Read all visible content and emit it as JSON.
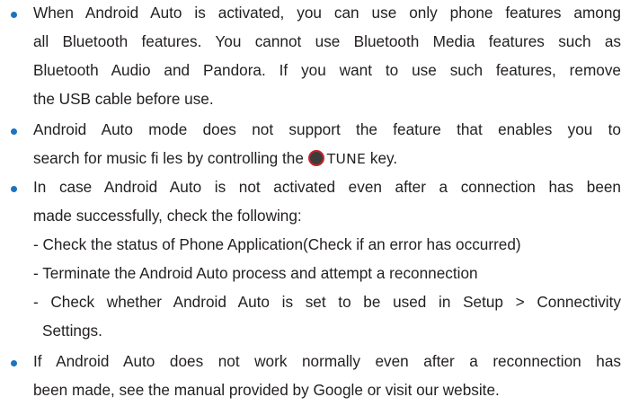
{
  "accent_color": "#1e73be",
  "bullets": [
    {
      "lines": [
        "When Android Auto is activated, you can use only phone features among",
        "all Bluetooth features. You cannot use Bluetooth Media features such as",
        "Bluetooth Audio and Pandora. If you want to use such features, remove",
        "the USB cable before use."
      ]
    },
    {
      "lines": [
        "Android Auto mode does not support the feature that enables you to",
        "search for music fi les by controlling the"
      ],
      "key_icon": "tune-knob-icon",
      "key_label": "TUNE",
      "key_suffix": " key."
    },
    {
      "lines": [
        "In case Android Auto is not activated even after a connection has been",
        "made successfully, check the following:"
      ],
      "sub_items": [
        "- Check the status of Phone Application(Check if an error has occurred)",
        "- Terminate the Android Auto process and attempt a reconnection",
        "- Check whether Android Auto is set to be used in Setup > Connectivity",
        "Settings."
      ]
    },
    {
      "lines": [
        "If Android Auto does not work normally even after a reconnection has",
        "been made, see the manual provided by Google or visit our website."
      ]
    }
  ]
}
